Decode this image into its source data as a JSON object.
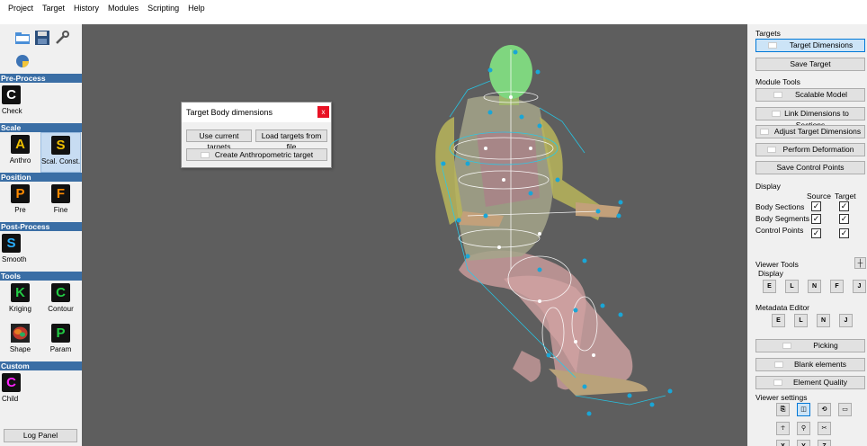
{
  "menu": [
    "Project",
    "Target",
    "History",
    "Modules",
    "Scripting",
    "Help"
  ],
  "left": {
    "sections": {
      "preprocess": "Pre-Process",
      "scale": "Scale",
      "position": "Position",
      "postprocess": "Post-Process",
      "tools": "Tools",
      "custom": "Custom"
    },
    "tools": {
      "check": {
        "glyph": "C",
        "label": "Check",
        "color": "#ffffff"
      },
      "anthro": {
        "glyph": "A",
        "label": "Anthro",
        "color": "#f0c000"
      },
      "scalconst": {
        "glyph": "S",
        "label": "Scal. Const.",
        "color": "#f0c000"
      },
      "pre": {
        "glyph": "P",
        "label": "Pre",
        "color": "#ff8a00"
      },
      "fine": {
        "glyph": "F",
        "label": "Fine",
        "color": "#ff8a00"
      },
      "smooth": {
        "glyph": "S",
        "label": "Smooth",
        "color": "#2ab0ff"
      },
      "kriging": {
        "glyph": "K",
        "label": "Kriging",
        "color": "#22cc44"
      },
      "contour": {
        "glyph": "C",
        "label": "Contour",
        "color": "#22cc44"
      },
      "shape": {
        "label": "Shape"
      },
      "param": {
        "glyph": "P",
        "label": "Param",
        "color": "#22cc44"
      },
      "child": {
        "glyph": "C",
        "label": "Child",
        "color": "#ff22ff"
      }
    },
    "log_panel": "Log Panel"
  },
  "dialog": {
    "title": "Target Body dimensions",
    "close": "x",
    "use_current": "Use current targets",
    "load_file": "Load targets from file",
    "create": "Create Anthropometric target"
  },
  "right": {
    "targets_label": "Targets",
    "target_dimensions": "Target Dimensions",
    "save_target": "Save Target",
    "module_tools_label": "Module Tools",
    "scalable_model": "Scalable Model",
    "link_dimensions": "Link Dimensions to Sections",
    "adjust_target": "Adjust Target Dimensions",
    "perform_deformation": "Perform Deformation",
    "save_control_points": "Save Control Points",
    "display_label": "Display",
    "source": "Source",
    "target": "Target",
    "display_rows": [
      {
        "label": "Body Sections",
        "source": true,
        "target": true
      },
      {
        "label": "Body Segments",
        "source": true,
        "target": true
      },
      {
        "label": "Control Points",
        "source": true,
        "target": true
      }
    ],
    "viewer_tools_label": "Viewer Tools",
    "viewer_display_label": "Display",
    "display_buttons": [
      "E",
      "L",
      "N",
      "F",
      "J"
    ],
    "metadata_editor_label": "Metadata Editor",
    "metadata_buttons": [
      "E",
      "L",
      "N",
      "J"
    ],
    "picking": "Picking",
    "blank_elements": "Blank elements",
    "element_quality": "Element Quality",
    "viewer_settings_label": "Viewer settings",
    "axis_buttons": [
      "X",
      "Y",
      "Z"
    ]
  }
}
